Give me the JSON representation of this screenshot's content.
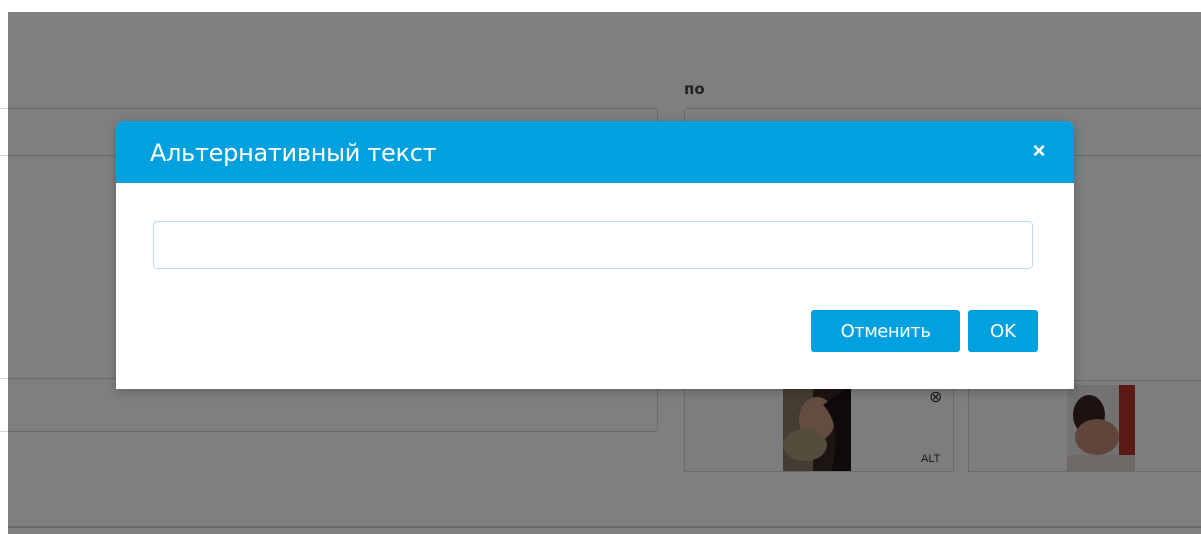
{
  "background": {
    "field_label": "по",
    "thumbnails": [
      {
        "remove_icon": "⊗",
        "alt_label": "ALT"
      },
      {
        "remove_icon": "",
        "alt_label": ""
      }
    ]
  },
  "dialog": {
    "title": "Альтернативный текст",
    "close_icon": "×",
    "alt_input": {
      "value": "",
      "placeholder": ""
    },
    "cancel_label": "Отменить",
    "ok_label": "OK"
  },
  "colors": {
    "accent": "#00a1de",
    "overlay": "rgba(0,0,0,0.5)"
  }
}
